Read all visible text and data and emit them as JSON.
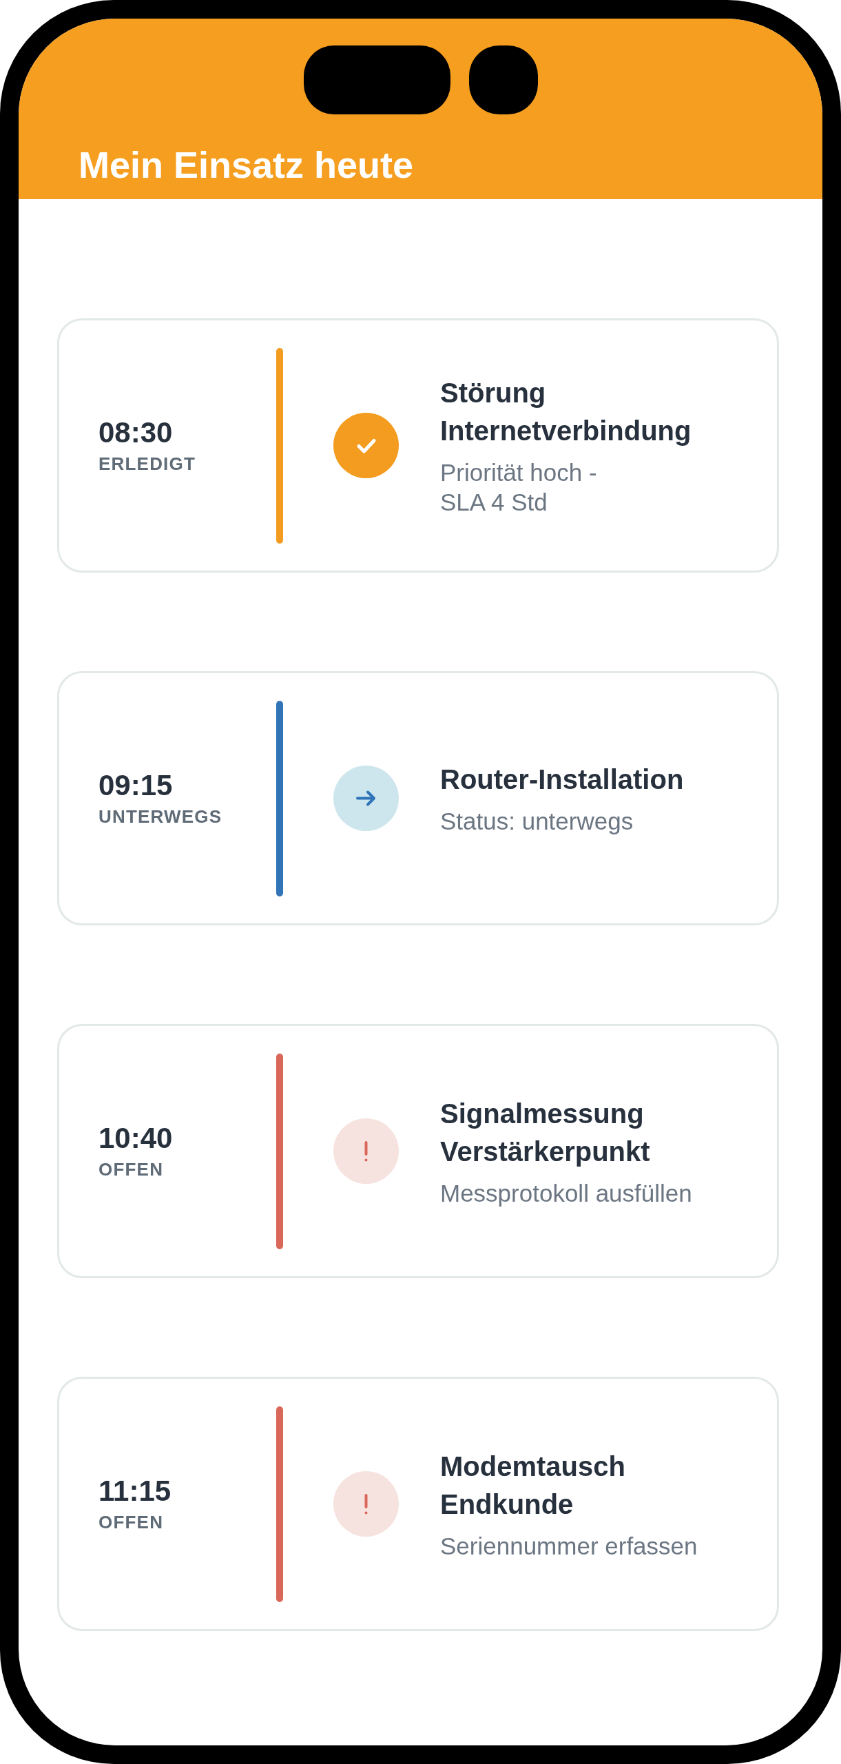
{
  "header": {
    "title": "Mein Einsatz heute"
  },
  "jobs": [
    {
      "time": "08:30",
      "status_label": "ERLEDIGT",
      "kind": "done",
      "color": "#f39c1f",
      "title": "Störung Internetverbindung",
      "detail_lines": [
        "Priorität hoch -",
        "SLA 4 Std"
      ]
    },
    {
      "time": "09:15",
      "status_label": "UNTERWEGS",
      "kind": "transit",
      "color": "#3274b8",
      "title": "Router-Installation",
      "detail_lines": [
        "Status: unterwegs"
      ]
    },
    {
      "time": "10:40",
      "status_label": "OFFEN",
      "kind": "open",
      "color": "#d9675a",
      "title": "Signalmessung Verstärkerpunkt",
      "detail_lines": [
        "Messprotokoll ausfüllen"
      ]
    },
    {
      "time": "11:15",
      "status_label": "OFFEN",
      "kind": "open",
      "color": "#d9675a",
      "title": "Modemtausch Endkunde",
      "detail_lines": [
        "Seriennummer erfassen"
      ]
    }
  ]
}
